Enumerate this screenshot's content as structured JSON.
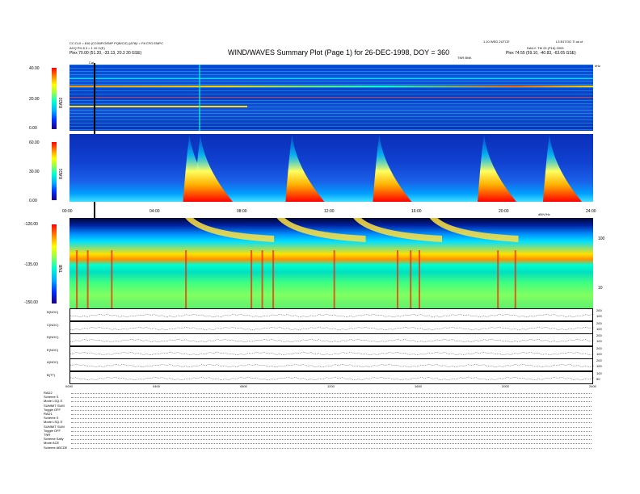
{
  "header": {
    "left_line1": "CC:CL0 = 816 (CC0NFIGEMP PQB/CIC) (878)/ = F8 CFG EMPC",
    "left_line2": "ACQ PH 8 3 = 1 10 C(E)",
    "left_line3": "Plex    70.00 (51.20, -33.13, 20.3 30 GSE)",
    "title": "WIND/WAVES Summary Plot (Page 1) for 26-DEC-1998, DOY = 360",
    "right_line1": "1.10 WED 2UTCE",
    "right_line1b": "L3 B1TOO TI uk ct",
    "right_line2": "DAILY: TM 23 (P16) 2003",
    "right_line3": "Plex    74.55 (59.10, -40.83, -63.05 GSE)",
    "tnr_label": "TNR BNK",
    "cal_label": "Cal"
  },
  "panels": {
    "rad2": {
      "label": "RAD2",
      "ticks": [
        "40.00",
        "20.00",
        "0.00"
      ],
      "unit_label": "kHz"
    },
    "rad1": {
      "label": "RAD1",
      "ticks": [
        "60.00",
        "30.00",
        "0.00"
      ]
    },
    "tnr": {
      "label": "TNR",
      "ticks": [
        "-120.00",
        "-135.00",
        "-150.00"
      ],
      "right_ticks": [
        "100",
        "10"
      ],
      "right_label": "dB/V/Hz"
    }
  },
  "time_axis": {
    "labels": [
      "00:00",
      "04:00",
      "08:00",
      "12:00",
      "16:00",
      "20:00",
      "24:00"
    ],
    "small_labels": [
      "0000",
      "0400",
      "0800",
      "1200",
      "1600",
      "2000",
      "2400"
    ]
  },
  "line_panels": [
    {
      "label": "B(NOC)",
      "right": [
        "200",
        "100"
      ]
    },
    {
      "label": "C(NOC)",
      "right": [
        "200",
        "100"
      ]
    },
    {
      "label": "D(NOC)",
      "right": [
        "200",
        "100"
      ]
    },
    {
      "label": "E(NOC)",
      "right": [
        "200",
        "100"
      ]
    },
    {
      "label": "A(NOC)",
      "right": [
        "200",
        "100"
      ]
    },
    {
      "label": "B(TT)",
      "right": [
        "100",
        "50"
      ]
    }
  ],
  "info_block": [
    "RAD2",
    "Scheme      S",
    "Mode    LSQ-S",
    "SUMMIT  SUM",
    "Toggle   OFF",
    "RAD1",
    "Scheme      S",
    "Mode  LSQ-S",
    "SUMMIT SUM",
    "Toggle   OFF",
    "TNR",
    "Scheme  Sally",
    "Mode     ACE",
    "Scheme ABCDE"
  ],
  "chart_data": [
    {
      "type": "heatmap",
      "title": "WIND/WAVES Summary Plot (Page 1) for 26-DEC-1998, DOY = 360",
      "xlabel": "",
      "ylabel": "RAD2",
      "xlim": [
        "00:00",
        "24:00"
      ],
      "ylim": [
        0,
        40
      ],
      "colorbar": [
        "#1a0080",
        "#0030ff",
        "#00b0ff",
        "#00ffd0",
        "#a0ff40",
        "#ffff00",
        "#ff9000",
        "#ff0000"
      ]
    },
    {
      "type": "heatmap",
      "ylabel": "RAD1",
      "xlim": [
        "00:00",
        "24:00"
      ],
      "ylim": [
        0,
        60
      ],
      "bursts_hours": [
        5.5,
        6.0,
        10.2,
        14.2,
        19.0,
        22.0
      ]
    },
    {
      "type": "heatmap",
      "ylabel": "TNR",
      "xlim": [
        "00:00",
        "24:00"
      ],
      "ylim": [
        -150,
        -120
      ],
      "bursts_hours": [
        5.3,
        9.5,
        13.0,
        16.5
      ]
    }
  ]
}
